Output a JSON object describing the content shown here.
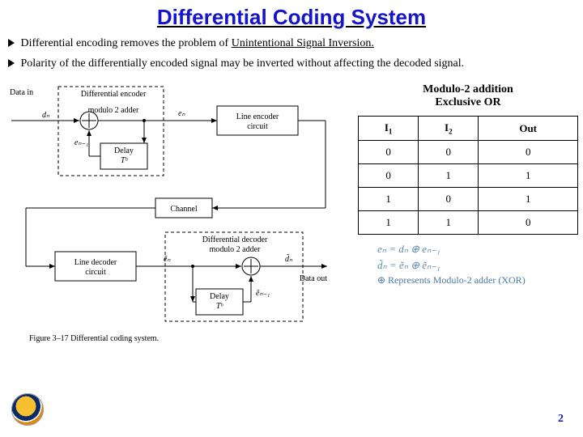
{
  "title": "Differential Coding System",
  "bullets": {
    "b1_pre": "Differential encoding removes the problem of ",
    "b1_uline": "Unintentional Signal Inversion.",
    "b2": "Polarity of the differentially encoded signal may be inverted without affecting the decoded signal."
  },
  "diagram": {
    "data_in": "Data in",
    "diff_encoder_l1": "Differential encoder",
    "mod2_adder": "modulo 2 adder",
    "line_encoder_l1": "Line encoder",
    "line_encoder_l2": "circuit",
    "delay": "Delay",
    "Tb": "T_b",
    "channel": "Channel",
    "line_decoder_l1": "Line decoder",
    "line_decoder_l2": "circuit",
    "diff_decoder_l1": "Differential decoder",
    "data_out": "Data out",
    "dn": "dₙ",
    "en": "eₙ",
    "en1": "eₙ₋₁",
    "etn": "ẽₙ",
    "etn1": "ẽₙ₋₁",
    "dtn": "d̃ₙ",
    "caption": "Figure 3–17  Differential coding system."
  },
  "side": {
    "heading_l1": "Modulo-2 addition",
    "heading_l2": "Exclusive OR",
    "cols": {
      "c1": "I",
      "c1s": "1",
      "c2": "I",
      "c2s": "2",
      "c3": "Out"
    },
    "rows": [
      {
        "a": "0",
        "b": "0",
        "o": "0"
      },
      {
        "a": "0",
        "b": "1",
        "o": "1"
      },
      {
        "a": "1",
        "b": "0",
        "o": "1"
      },
      {
        "a": "1",
        "b": "1",
        "o": "0"
      }
    ],
    "f1": "eₙ = dₙ ⊕ eₙ₋₁",
    "f2": "d̃ₙ = ẽₙ ⊕ ẽₙ₋₁",
    "rep": "⊕ Represents Modulo-2 adder (XOR)"
  },
  "page_number": "2"
}
